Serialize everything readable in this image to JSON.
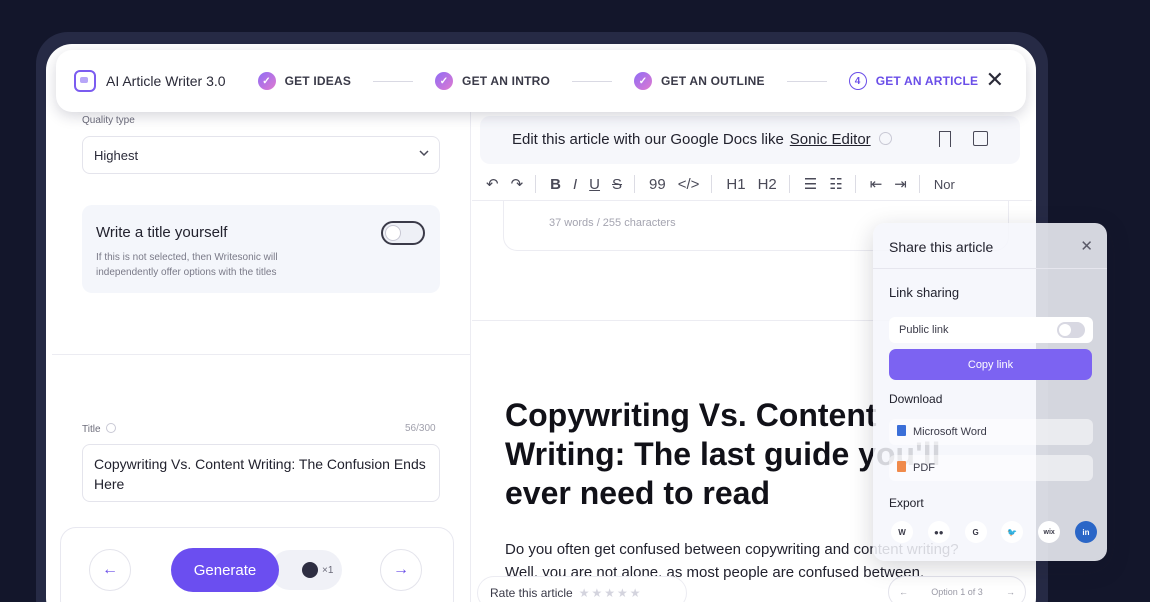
{
  "app": {
    "title": "AI Article Writer 3.0"
  },
  "steps": [
    {
      "label": "GET IDEAS",
      "marker": "✓"
    },
    {
      "label": "GET AN INTRO",
      "marker": "✓"
    },
    {
      "label": "GET AN OUTLINE",
      "marker": "✓"
    },
    {
      "label": "GET AN ARTICLE",
      "marker": "4"
    }
  ],
  "close_glyph": "✕",
  "left": {
    "quality_label": "Quality type",
    "quality_value": "Highest",
    "toggle_title": "Write a title yourself",
    "toggle_desc": "If this is not selected, then Writesonic will independently offer options with the titles",
    "title_label": "Title",
    "title_count": "56/300",
    "title_value": "Copywriting Vs. Content Writing: The Confusion Ends Here",
    "generate_label": "Generate",
    "credits": "×1",
    "prev_glyph": "←",
    "next_glyph": "→"
  },
  "editor": {
    "banner_text": "Edit this article with our Google Docs like",
    "banner_link": "Sonic Editor",
    "toolbar": [
      "↶",
      "↷",
      "B",
      "I",
      "U",
      "S",
      "99",
      "</>",
      "H1",
      "H2",
      "☰",
      "☷",
      "⇤",
      "⇥",
      "Nor"
    ],
    "word_count": "37 words / 255 characters",
    "heading": "Copywriting Vs. Content Writing: The last guide you'll ever need to read",
    "paragraph": "Do you often get confused between copywriting and content writing? Well, you are not alone, as most people are confused between.",
    "rate_label": "Rate this article",
    "stars": "★★★★★",
    "option_label": "Option 1 of 3",
    "option_prev": "←",
    "option_next": "→"
  },
  "share": {
    "title": "Share this article",
    "close": "✕",
    "link_sharing": "Link sharing",
    "public_link": "Public link",
    "copy_link": "Copy link",
    "download": "Download",
    "word": "Microsoft Word",
    "pdf": "PDF",
    "export": "Export",
    "export_targets": [
      "W",
      "●●",
      "G",
      "🐦",
      "wix",
      "in"
    ]
  },
  "colors": {
    "accent": "#6b4ef0",
    "accent_light": "#7c63f2",
    "background": "#13162b"
  }
}
